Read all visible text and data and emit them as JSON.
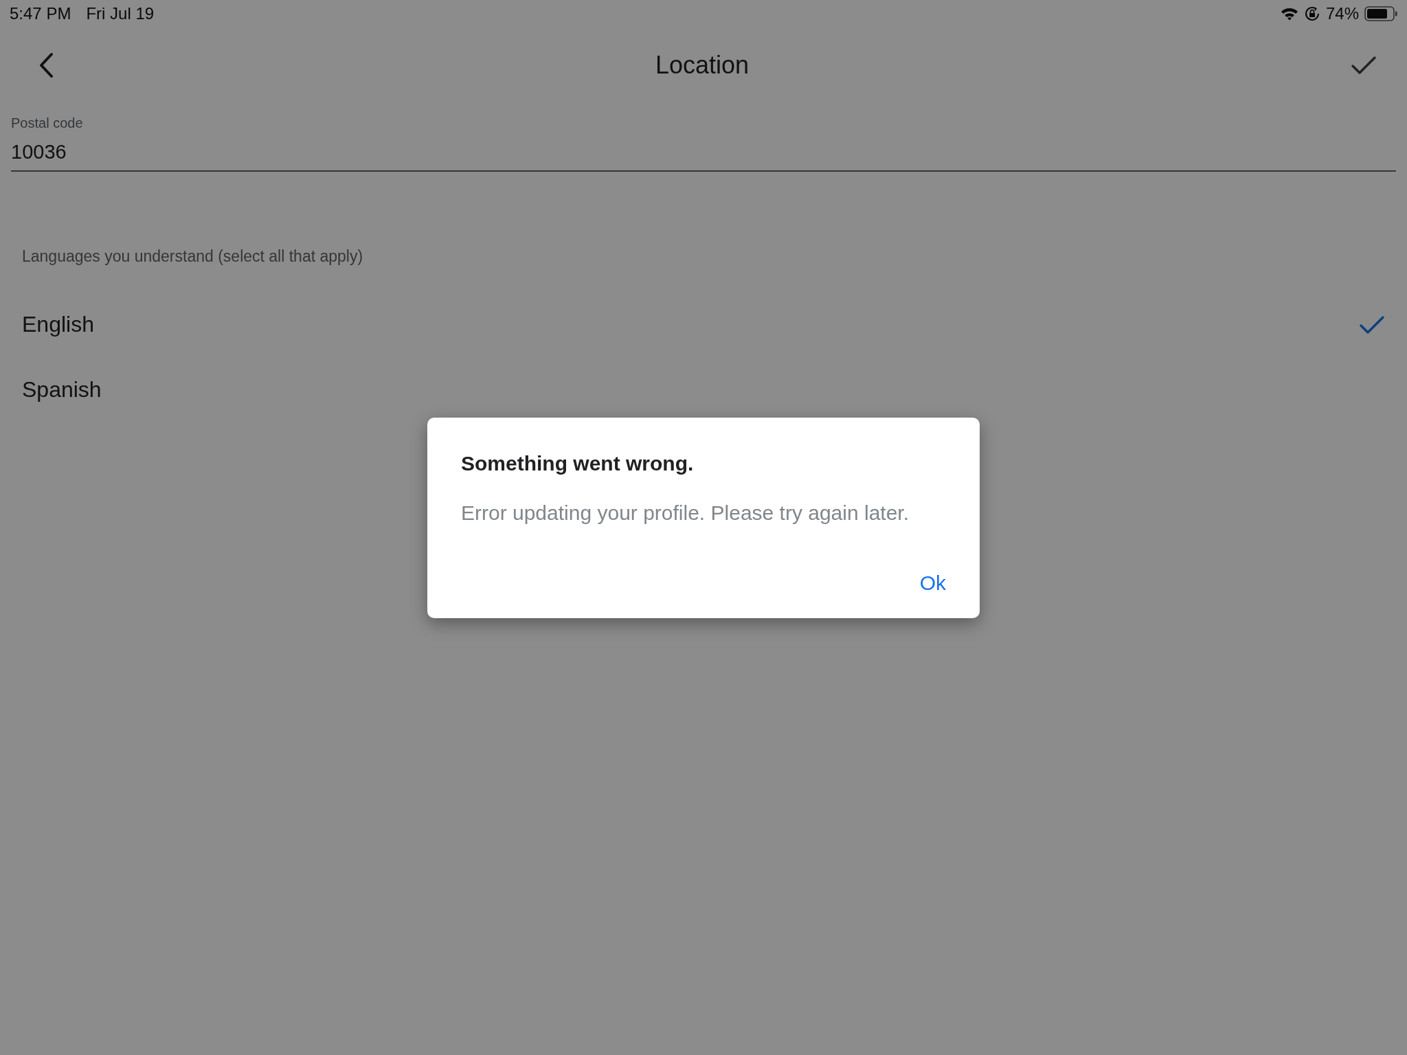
{
  "status_bar": {
    "time": "5:47 PM",
    "date": "Fri Jul 19",
    "battery_percent": "74%"
  },
  "header": {
    "title": "Location"
  },
  "postal_code": {
    "label": "Postal code",
    "value": "10036"
  },
  "languages": {
    "label": "Languages you understand (select all that apply)",
    "items": [
      {
        "name": "English",
        "checked": true
      },
      {
        "name": "Spanish",
        "checked": false
      }
    ]
  },
  "dialog": {
    "title": "Something went wrong.",
    "message": "Error updating your profile. Please try again later.",
    "buttons": [
      "Ok"
    ]
  }
}
